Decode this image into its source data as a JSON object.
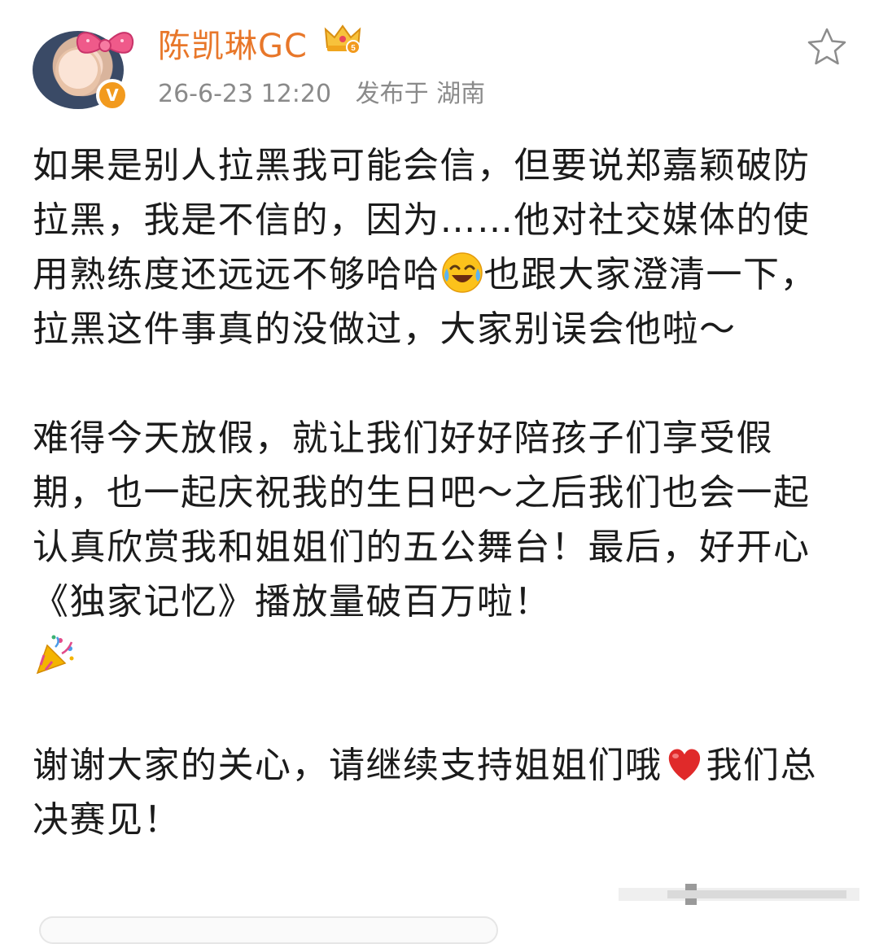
{
  "post": {
    "author": "陈凯琳GC",
    "date": "26-6-23 12:20",
    "location": "发布于 湖南",
    "paragraphs": [
      [
        "如果是别人拉黑我可能会信，但要说郑嘉颖破防拉黑，我是不信的，因为……他对社交媒体的使用熟练度还远远不够哈哈",
        "也跟大家澄清一下，拉黑这件事真的没做过，大家别误会他啦～"
      ],
      [
        "难得今天放假，就让我们好好陪孩子们享受假期，也一起庆祝我的生日吧～之后我们也会一起认真欣赏我和姐姐们的五公舞台！最后，好开心《独家记忆》播放量破百万啦！"
      ],
      [
        "谢谢大家的关心，请继续支持姐姐们哦",
        "我们总决赛见！"
      ]
    ]
  },
  "icons": {
    "avatar": "avatar-image",
    "verified_badge": "verified-v-icon",
    "member_badge": "crown-member-icon",
    "favorite": "star-icon",
    "emoji_1": "laughing-tears-emoji",
    "emoji_2": "party-popper-emoji",
    "emoji_3": "red-heart-emoji"
  },
  "colors": {
    "username": "#e8772a",
    "meta": "#8a8a8a",
    "verified": "#f29a1e",
    "text": "#1b1b1b"
  }
}
